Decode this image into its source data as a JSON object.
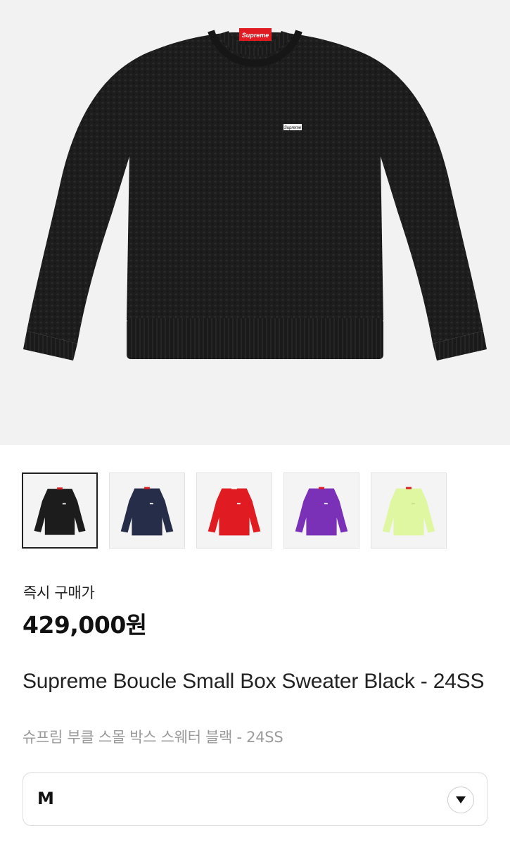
{
  "product_image": {
    "alt": "Supreme Boucle Small Box Sweater Black",
    "logo_text": "Supreme"
  },
  "colors": {
    "hero_bg": "#f2f2f2",
    "variants": [
      "#1c1c1c",
      "#262d48",
      "#e01b21",
      "#7a31b8",
      "#def7a0"
    ]
  },
  "thumbnails": [
    {
      "color_name": "Black",
      "color": "#1c1c1c",
      "selected": true
    },
    {
      "color_name": "Navy",
      "color": "#262d48",
      "selected": false
    },
    {
      "color_name": "Red",
      "color": "#e01b21",
      "selected": false
    },
    {
      "color_name": "Purple",
      "color": "#7a31b8",
      "selected": false
    },
    {
      "color_name": "Lime",
      "color": "#def7a0",
      "selected": false
    }
  ],
  "price": {
    "label": "즉시 구매가",
    "value": "429,000원"
  },
  "product": {
    "title_en": "Supreme Boucle Small Box Sweater Black - 24SS",
    "title_ko": "슈프림 부클 스몰 박스 스웨터 블랙 - 24SS"
  },
  "size_selector": {
    "selected": "M",
    "icon": "chevron-down-icon"
  }
}
